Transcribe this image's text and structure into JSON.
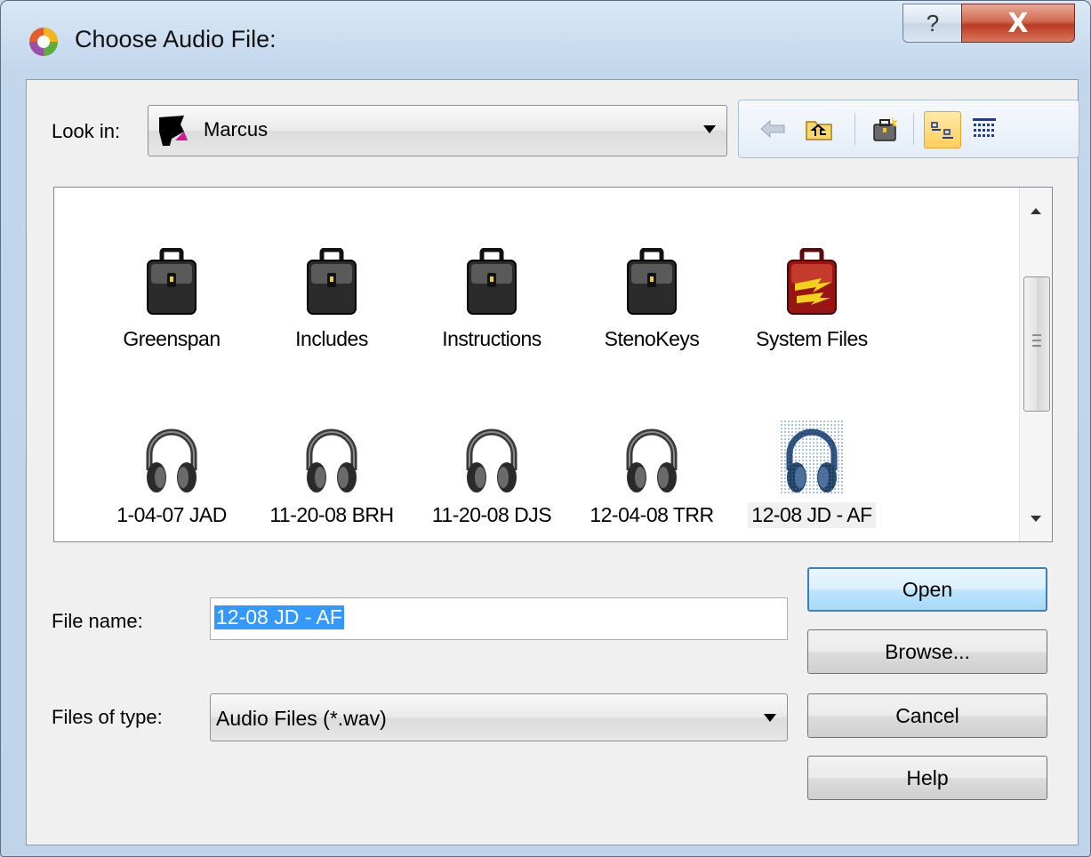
{
  "window": {
    "title": "Choose Audio File:"
  },
  "titlebar": {
    "help_label": "?",
    "close_label": "X"
  },
  "lookin": {
    "label": "Look in:",
    "value": "Marcus"
  },
  "toolbar": {
    "icons": [
      "back-arrow-icon",
      "up-folder-icon",
      "new-folder-icon",
      "list-view-icon",
      "details-view-icon"
    ],
    "active": "list-view-icon"
  },
  "files": [
    {
      "name": "Greenspan",
      "type": "folder"
    },
    {
      "name": "Includes",
      "type": "folder"
    },
    {
      "name": "Instructions",
      "type": "folder"
    },
    {
      "name": "StenoKeys",
      "type": "folder"
    },
    {
      "name": "System Files",
      "type": "system-folder"
    },
    {
      "name": "1-04-07 JAD",
      "type": "audio"
    },
    {
      "name": "11-20-08 BRH",
      "type": "audio"
    },
    {
      "name": "11-20-08 DJS",
      "type": "audio"
    },
    {
      "name": "12-04-08 TRR",
      "type": "audio"
    },
    {
      "name": "12-08 JD - AF",
      "type": "audio",
      "selected": true
    }
  ],
  "filename": {
    "label": "File name:",
    "value": "12-08 JD - AF"
  },
  "filetype": {
    "label": "Files of type:",
    "value": "Audio Files (*.wav)"
  },
  "buttons": {
    "open": "Open",
    "browse": "Browse...",
    "cancel": "Cancel",
    "help": "Help"
  }
}
